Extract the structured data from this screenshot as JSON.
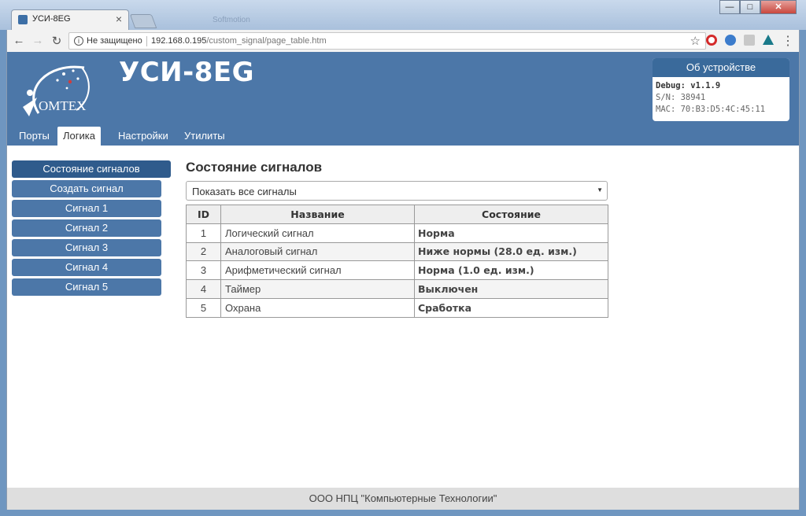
{
  "browser": {
    "tab_title": "УСИ-8EG",
    "tab_close": "×",
    "ghost_tab": "Softmotion",
    "security_label": "Не защищено",
    "url_host": "192.168.0.195",
    "url_path": "/custom_signal/page_table.htm",
    "window_buttons": {
      "minimize": "—",
      "maximize": "□",
      "close": "✕"
    }
  },
  "header": {
    "logo_text": "OMTEX",
    "device_title": "УСИ-8EG"
  },
  "device_info": {
    "title": "Об устройстве",
    "debug": "Debug: v1.1.9",
    "serial": "S/N: 38941",
    "mac": "MAC: 70:B3:D5:4C:45:11"
  },
  "main_nav": {
    "items": [
      "Порты",
      "Логика",
      "Настройки",
      "Утилиты"
    ],
    "active": "Логика"
  },
  "sidebar": {
    "items": [
      "Состояние сигналов",
      "Создать сигнал",
      "Сигнал 1",
      "Сигнал 2",
      "Сигнал 3",
      "Сигнал 4",
      "Сигнал 5"
    ],
    "active": "Состояние сигналов"
  },
  "content": {
    "title": "Состояние сигналов",
    "filter_value": "Показать все сигналы"
  },
  "table": {
    "headers": [
      "ID",
      "Название",
      "Состояние"
    ],
    "rows": [
      {
        "id": "1",
        "name": "Логический сигнал",
        "state": "Норма",
        "status": "ok"
      },
      {
        "id": "2",
        "name": "Аналоговый сигнал",
        "state": "Ниже нормы (28.0 ед. изм.)",
        "status": "alarm"
      },
      {
        "id": "3",
        "name": "Арифметический сигнал",
        "state": "Норма (1.0 ед. изм.)",
        "status": "ok"
      },
      {
        "id": "4",
        "name": "Таймер",
        "state": "Выключен",
        "status": "off"
      },
      {
        "id": "5",
        "name": "Охрана",
        "state": "Сработка",
        "status": "alarm"
      }
    ]
  },
  "colors": {
    "header_blue": "#4c77a8",
    "active_blue": "#2f5b8c",
    "status_ok": "#3aab62",
    "status_alarm": "#d0504a",
    "status_off": "#333333"
  },
  "footer": {
    "text": "ООО НПЦ \"Компьютерные Технологии\""
  }
}
